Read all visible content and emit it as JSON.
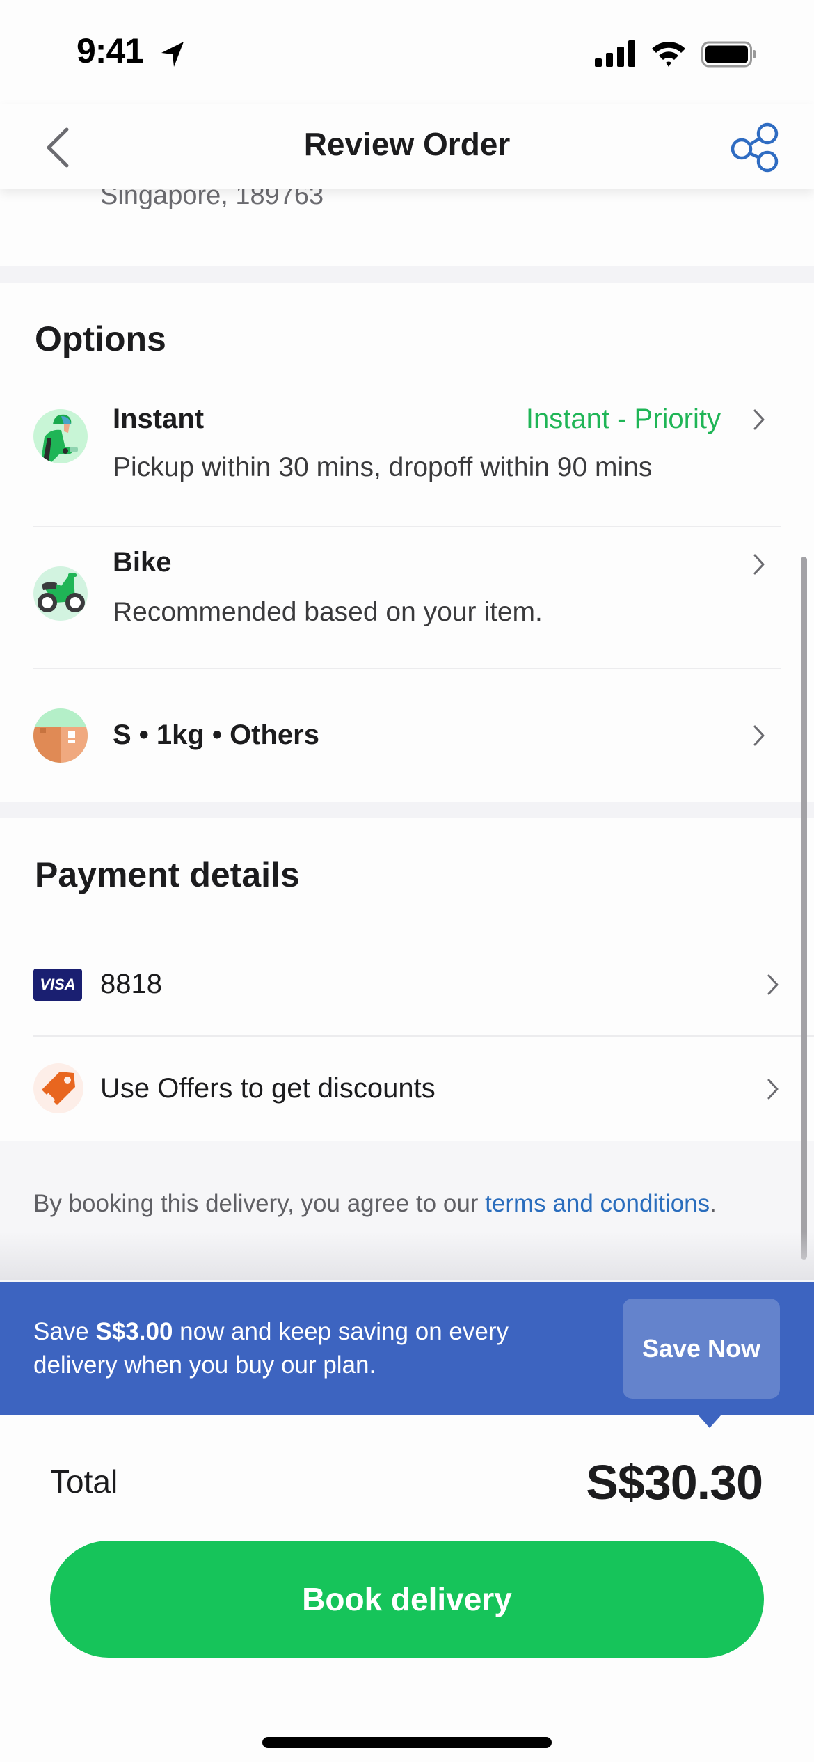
{
  "status_bar": {
    "time": "9:41"
  },
  "nav": {
    "title": "Review Order"
  },
  "address": {
    "tail": "Singapore, 189763"
  },
  "options": {
    "title": "Options",
    "items": [
      {
        "icon": "rider-icon",
        "title": "Instant",
        "value": "Instant - Priority",
        "subtitle": "Pickup within 30 mins, dropoff within 90 mins"
      },
      {
        "icon": "motorbike-icon",
        "title": "Bike",
        "value": "",
        "subtitle": "Recommended based on your item."
      },
      {
        "icon": "parcel-box-icon",
        "title": "S • 1kg • Others",
        "value": "",
        "subtitle": ""
      }
    ]
  },
  "payment": {
    "title": "Payment details",
    "items": [
      {
        "icon": "visa-card-icon",
        "badge": "VISA",
        "label": "8818"
      },
      {
        "icon": "offer-tag-icon",
        "label": "Use Offers to get discounts"
      }
    ]
  },
  "terms": {
    "prefix": "By booking this delivery, you agree to our ",
    "link": "terms and conditions",
    "suffix": "."
  },
  "promo": {
    "text_before": "Save ",
    "amount": "S$3.00",
    "text_after": " now and keep saving on every delivery when you buy our plan.",
    "button": "Save Now"
  },
  "footer": {
    "total_label": "Total",
    "total_value": "S$30.30",
    "book_button": "Book delivery"
  },
  "colors": {
    "accent_green": "#16c45a",
    "value_green": "#1fb556",
    "link_blue": "#2a6dbd",
    "promo_blue": "#3d64c0",
    "share_blue": "#2f6cc2"
  }
}
